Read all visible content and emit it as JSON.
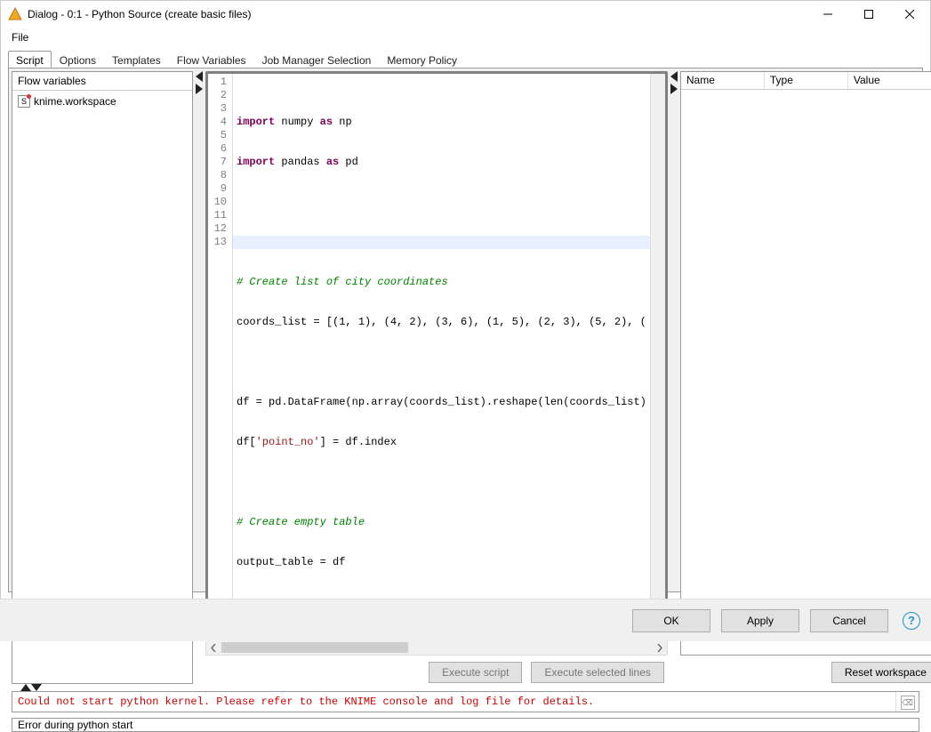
{
  "window": {
    "title": "Dialog - 0:1 - Python Source (create basic files)"
  },
  "menubar": {
    "file": "File"
  },
  "tabs": {
    "script": "Script",
    "options": "Options",
    "templates": "Templates",
    "flow_variables": "Flow Variables",
    "job_manager": "Job Manager Selection",
    "memory_policy": "Memory Policy"
  },
  "flow_panel": {
    "header": "Flow variables",
    "items": [
      {
        "label": "knime.workspace"
      }
    ]
  },
  "editor": {
    "lines": [
      {
        "n": "1",
        "code": "import numpy as np",
        "hl": "kw1"
      },
      {
        "n": "2",
        "code": "import pandas as pd",
        "hl": "kw1"
      },
      {
        "n": "3",
        "code": "",
        "hl": ""
      },
      {
        "n": "4",
        "code": "",
        "hl": ""
      },
      {
        "n": "5",
        "code": "# Create list of city coordinates",
        "hl": "cm"
      },
      {
        "n": "6",
        "code": "coords_list = [(1, 1), (4, 2), (3, 6), (1, 5), (2, 3), (5, 2), (",
        "hl": ""
      },
      {
        "n": "7",
        "code": "",
        "hl": ""
      },
      {
        "n": "8",
        "code": "df = pd.DataFrame(np.array(coords_list).reshape(len(coords_list)",
        "hl": ""
      },
      {
        "n": "9",
        "code": "df['point_no'] = df.index",
        "hl": ""
      },
      {
        "n": "10",
        "code": "",
        "hl": ""
      },
      {
        "n": "11",
        "code": "# Create empty table",
        "hl": "cm"
      },
      {
        "n": "12",
        "code": "output_table = df",
        "hl": ""
      },
      {
        "n": "13",
        "code": "",
        "hl": "cur"
      }
    ]
  },
  "editor_buttons": {
    "execute_script": "Execute script",
    "execute_selected": "Execute selected lines"
  },
  "var_table": {
    "headers": {
      "name": "Name",
      "type": "Type",
      "value": "Value"
    }
  },
  "reset_btn": "Reset workspace",
  "console": {
    "text": "Could not start python kernel. Please refer to the KNIME console and log file for details."
  },
  "status": "Error during python start",
  "footer": {
    "ok": "OK",
    "apply": "Apply",
    "cancel": "Cancel"
  }
}
